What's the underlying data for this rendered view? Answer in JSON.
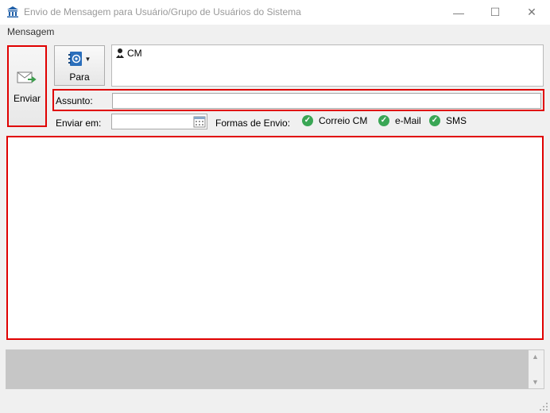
{
  "window": {
    "title": "Envio de Mensagem para Usuário/Grupo de Usuários do Sistema",
    "minimize_glyph": "—",
    "maximize_glyph": "☐",
    "close_glyph": "✕"
  },
  "menu": {
    "items": [
      {
        "label": "Mensagem"
      }
    ]
  },
  "toolbar": {
    "send_label": "Enviar",
    "to_label": "Para"
  },
  "recipients": [
    {
      "name": "CM",
      "icon": "user-icon"
    }
  ],
  "subject": {
    "label": "Assunto:",
    "value": ""
  },
  "schedule": {
    "label": "Enviar em:",
    "value": ""
  },
  "delivery": {
    "label": "Formas de Envio:",
    "options": [
      {
        "label": "Correio CM",
        "checked": true
      },
      {
        "label": "e-Mail",
        "checked": true
      },
      {
        "label": "SMS",
        "checked": true
      }
    ],
    "check_color": "#3aa655"
  },
  "message": {
    "body": ""
  },
  "colors": {
    "highlight": "#e00000",
    "accent": "#0078d7"
  }
}
